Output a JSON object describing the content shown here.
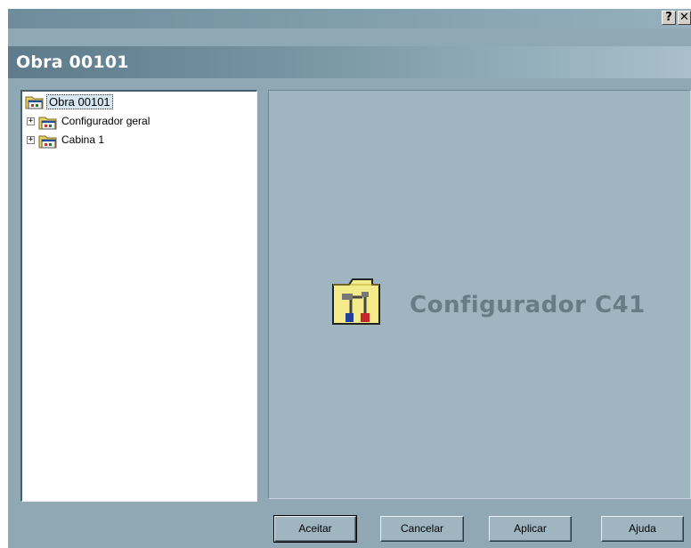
{
  "window": {
    "help_glyph": "?",
    "close_glyph": "✕",
    "title": "Obra 00101"
  },
  "tree": {
    "root": {
      "label": "Obra 00101",
      "icon": "folder-settings-icon"
    },
    "children": [
      {
        "label": "Configurador geral",
        "expander": "+",
        "icon": "folder-settings-icon"
      },
      {
        "label": "Cabina 1",
        "expander": "+",
        "icon": "folder-settings-icon"
      }
    ]
  },
  "content": {
    "logo_text": "Configurador C41",
    "logo_icon": "tools-folder-icon"
  },
  "buttons": {
    "accept": "Aceitar",
    "cancel": "Cancelar",
    "apply": "Aplicar",
    "help": "Ajuda"
  },
  "colors": {
    "panel": "#8fa8b4",
    "content": "#9fb5bf",
    "logo_text": "#697b83",
    "header_start": "#5d7b8b",
    "header_end": "#a9c0cb"
  }
}
